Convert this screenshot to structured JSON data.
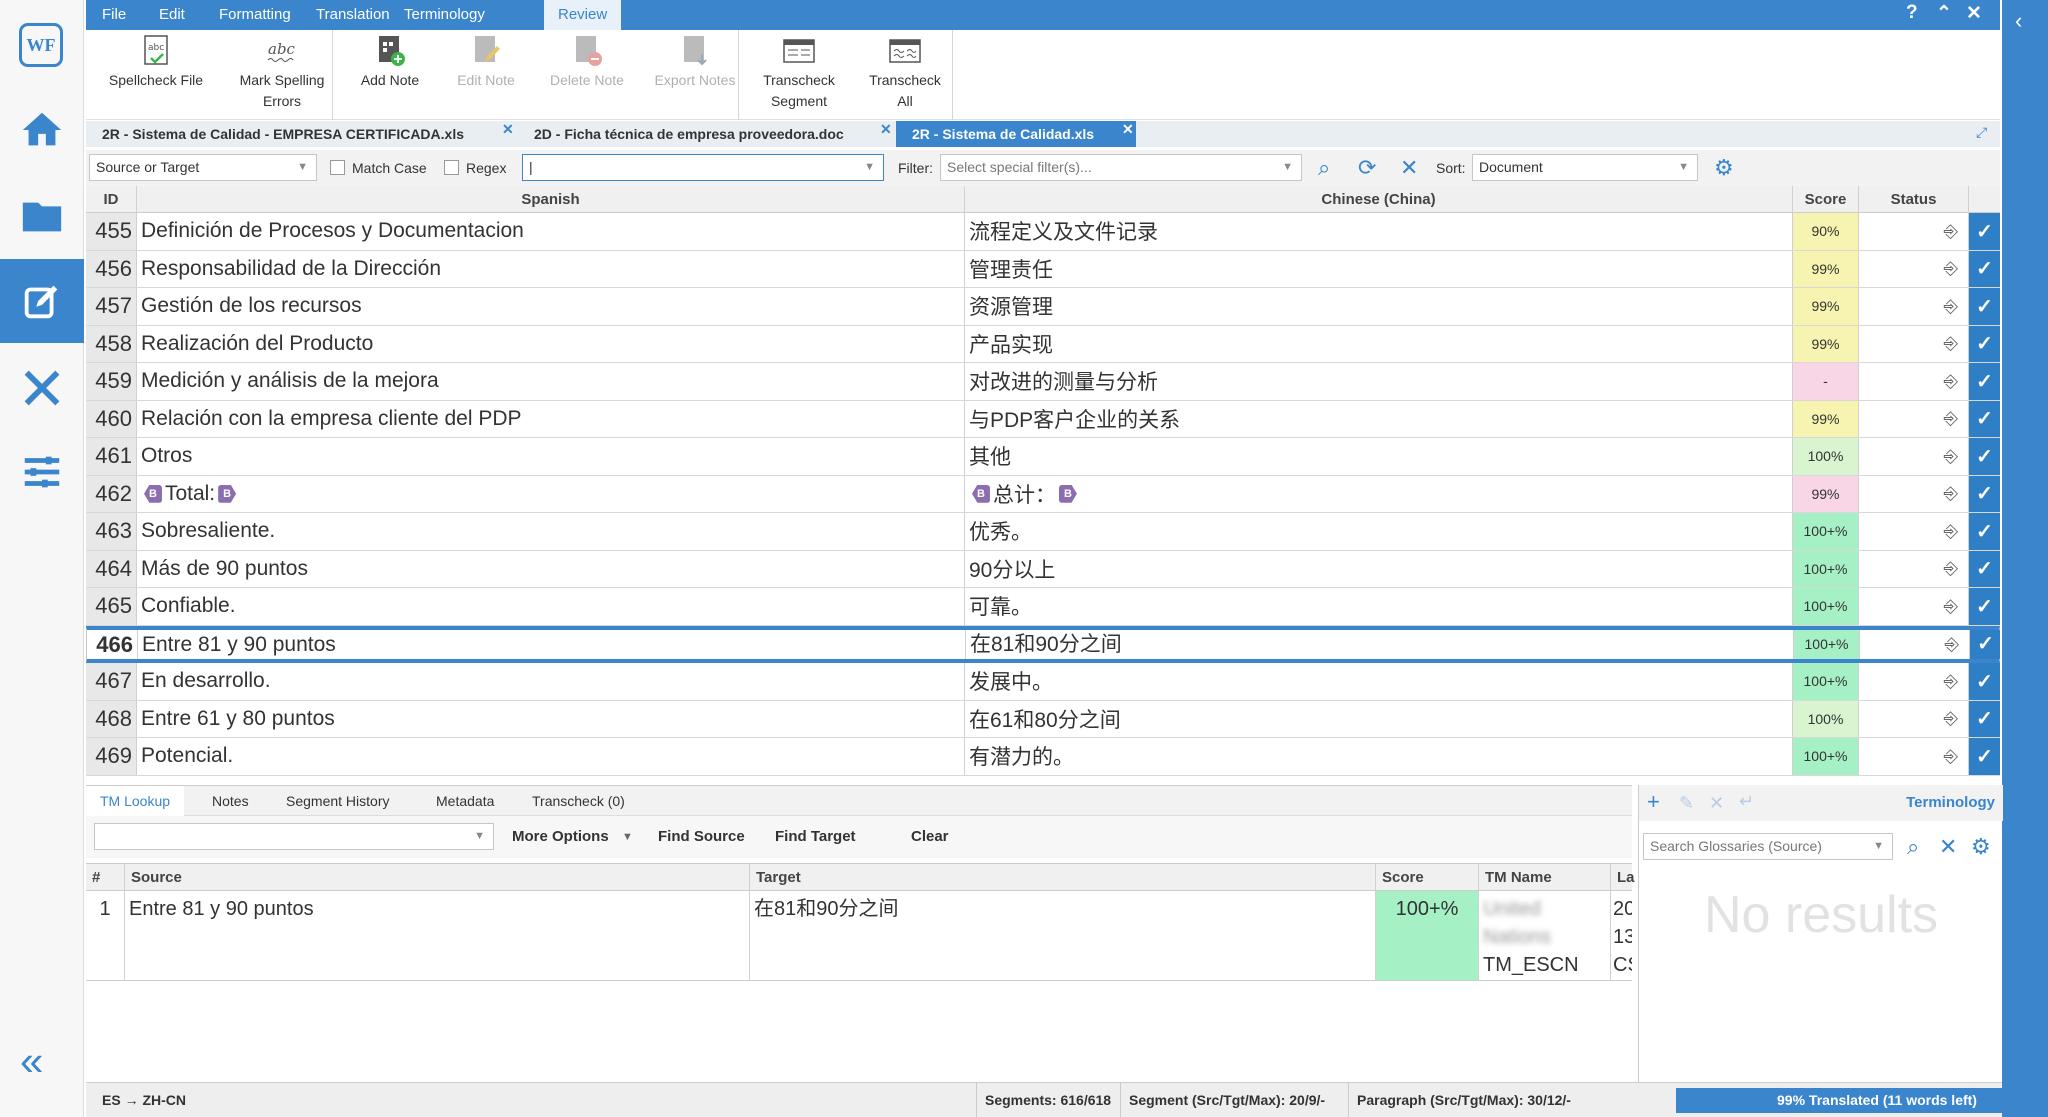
{
  "menu": {
    "file": "File",
    "edit": "Edit",
    "formatting": "Formatting",
    "translation": "Translation",
    "terminology": "Terminology",
    "review": "Review"
  },
  "ribbon": {
    "spellcheck": "Spellcheck File",
    "mark_spelling_1": "Mark Spelling",
    "mark_spelling_2": "Errors",
    "add_note": "Add Note",
    "edit_note": "Edit Note",
    "delete_note": "Delete Note",
    "export_notes": "Export Notes",
    "transcheck_seg_1": "Transcheck",
    "transcheck_seg_2": "Segment",
    "transcheck_all_1": "Transcheck",
    "transcheck_all_2": "All"
  },
  "tabs": [
    "2R - Sistema de Calidad - EMPRESA CERTIFICADA.xls",
    "2D - Ficha técnica de empresa proveedora.doc",
    "2R - Sistema de Calidad.xls"
  ],
  "filter": {
    "scope": "Source or Target",
    "match_case": "Match Case",
    "regex": "Regex",
    "filter_label": "Filter:",
    "filter_placeholder": "Select special filter(s)...",
    "sort_label": "Sort:",
    "sort_value": "Document"
  },
  "grid": {
    "headers": {
      "id": "ID",
      "source": "Spanish",
      "target": "Chinese (China)",
      "score": "Score",
      "status": "Status"
    },
    "rows": [
      {
        "id": "455",
        "source": "Definición de Procesos y Documentacion",
        "target": "流程定义及文件记录",
        "score": "90%",
        "color": "#f7f3b0"
      },
      {
        "id": "456",
        "source": "Responsabilidad de la Dirección",
        "target": "管理责任",
        "score": "99%",
        "color": "#f7f3b0"
      },
      {
        "id": "457",
        "source": "Gestión de los recursos",
        "target": "资源管理",
        "score": "99%",
        "color": "#f7f3b0"
      },
      {
        "id": "458",
        "source": "Realización del Producto",
        "target": "产品实现",
        "score": "99%",
        "color": "#f7f3b0"
      },
      {
        "id": "459",
        "source": "Medición y análisis de la mejora",
        "target": "对改进的测量与分析",
        "score": "-",
        "color": "#f9d6e6"
      },
      {
        "id": "460",
        "source": "Relación con la empresa cliente del PDP",
        "target": "与PDP客户企业的关系",
        "score": "99%",
        "color": "#f7f3b0"
      },
      {
        "id": "461",
        "source": "Otros",
        "target": "其他",
        "score": "100%",
        "color": "#d8f5d0"
      },
      {
        "id": "462",
        "source": "Total:",
        "target": "总计：",
        "score": "99%",
        "color": "#f9d6e6",
        "tag": "B"
      },
      {
        "id": "463",
        "source": "Sobresaliente.",
        "target": "优秀。",
        "score": "100+%",
        "color": "#a6f0c6"
      },
      {
        "id": "464",
        "source": "Más de 90 puntos",
        "target": "90分以上",
        "score": "100+%",
        "color": "#a6f0c6"
      },
      {
        "id": "465",
        "source": "Confiable.",
        "target": "可靠。",
        "score": "100+%",
        "color": "#a6f0c6"
      },
      {
        "id": "466",
        "source": "Entre 81 y 90 puntos",
        "target": "在81和90分之间",
        "score": "100+%",
        "color": "#a6f0c6",
        "selected": true
      },
      {
        "id": "467",
        "source": "En desarrollo.",
        "target": "发展中。",
        "score": "100+%",
        "color": "#a6f0c6"
      },
      {
        "id": "468",
        "source": "Entre 61 y 80 puntos",
        "target": "在61和80分之间",
        "score": "100%",
        "color": "#d8f5d0"
      },
      {
        "id": "469",
        "source": "Potencial.",
        "target": "有潜力的。",
        "score": "100+%",
        "color": "#a6f0c6"
      }
    ]
  },
  "bottom_tabs": [
    "TM Lookup",
    "Notes",
    "Segment History",
    "Metadata",
    "Transcheck (0)"
  ],
  "tm": {
    "more_options": "More Options",
    "find_source": "Find Source",
    "find_target": "Find Target",
    "clear": "Clear",
    "headers": {
      "num": "#",
      "source": "Source",
      "target": "Target",
      "score": "Score",
      "tm_name": "TM Name",
      "last": "La"
    },
    "row": {
      "num": "1",
      "source": "Entre 81 y 90 puntos",
      "target": "在81和90分之间",
      "score": "100+%",
      "tm_name_1": "United",
      "tm_name_2": "Nations",
      "tm_name_3": "TM_ESCN",
      "last_1": "20",
      "last_2": "13",
      "last_3": "CS"
    }
  },
  "terminology": {
    "title": "Terminology",
    "search_placeholder": "Search Glossaries (Source)",
    "empty": "No results"
  },
  "status": {
    "lang": "ES → ZH-CN",
    "segments": "Segments: 616/618",
    "segment_stats": "Segment (Src/Tgt/Max): 20/9/-",
    "paragraph_stats": "Paragraph (Src/Tgt/Max): 30/12/-",
    "progress": "99% Translated (11 words left)",
    "progress_value": 0.99
  },
  "colors": {
    "accent": "#3a85cc",
    "check": "#2f7fc6"
  }
}
